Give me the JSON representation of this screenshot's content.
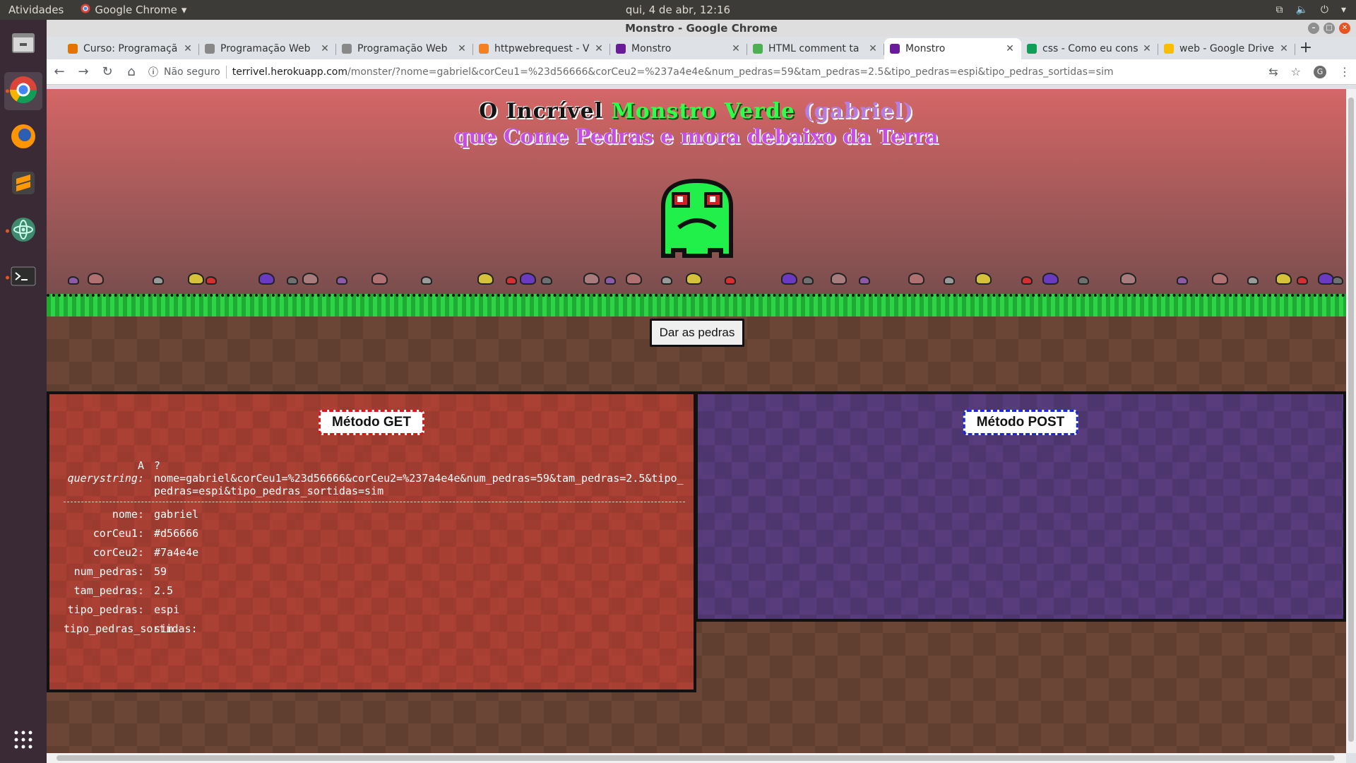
{
  "system": {
    "activities": "Atividades",
    "app_menu": "Google Chrome",
    "clock": "qui,  4 de abr, 12:16"
  },
  "window": {
    "title": "Monstro - Google Chrome"
  },
  "tabs": [
    {
      "title": "Curso: Programaçã",
      "favicon_color": "#e37400",
      "icon": "course-icon"
    },
    {
      "title": "Programação Web",
      "favicon_color": "#888888",
      "icon": "globe-icon"
    },
    {
      "title": "Programação Web",
      "favicon_color": "#888888",
      "icon": "globe-icon"
    },
    {
      "title": "httpwebrequest - V",
      "favicon_color": "#f48024",
      "icon": "stackoverflow-icon"
    },
    {
      "title": "Monstro",
      "favicon_color": "#6a1b9a",
      "icon": "monster-icon"
    },
    {
      "title": "HTML comment ta",
      "favicon_color": "#4caf50",
      "icon": "w3-icon"
    },
    {
      "title": "Monstro",
      "favicon_color": "#6a1b9a",
      "icon": "monster-icon",
      "active": true
    },
    {
      "title": "css - Como eu cons",
      "favicon_color": "#0f9d58",
      "icon": "sheets-icon"
    },
    {
      "title": "web - Google Drive",
      "favicon_color": "#fbbc04",
      "icon": "drive-icon"
    }
  ],
  "toolbar": {
    "insecure_label": "Não seguro",
    "url_host": "terrivel.herokuapp.com",
    "url_path": "/monster/?nome=gabriel&corCeu1=%23d56666&corCeu2=%237a4e4e&num_pedras=59&tam_pedras=2.5&tipo_pedras=espi&tipo_pedras_sortidas=sim",
    "avatar_letter": "G"
  },
  "page": {
    "sky_colors": [
      "#d56666",
      "#7a4e4e"
    ],
    "title_part1": "O Incrível ",
    "title_part2": "Monstro Verde",
    "title_part3": " (gabriel)",
    "title_line2": "que Come Pedras e mora debaixo da Terra",
    "give_button": "Dar as pedras",
    "get_label": "Método GET",
    "post_label": "Método POST",
    "qs_a_label": "A",
    "qs_a_value": "?",
    "qs_label": "querystring:",
    "qs_value": "nome=gabriel&corCeu1=%23d56666&corCeu2=%237a4e4e&num_pedras=59&tam_pedras=2.5&tipo_pedras=espi&tipo_pedras_sortidas=sim",
    "params": [
      {
        "key": "nome:",
        "value": "gabriel"
      },
      {
        "key": "corCeu1:",
        "value": "#d56666"
      },
      {
        "key": "corCeu2:",
        "value": "#7a4e4e"
      },
      {
        "key": "num_pedras:",
        "value": "59"
      },
      {
        "key": "tam_pedras:",
        "value": "2.5"
      },
      {
        "key": "tipo_pedras:",
        "value": "espi"
      },
      {
        "key": "tipo_pedras_sortidas:",
        "value": "sim"
      }
    ]
  }
}
